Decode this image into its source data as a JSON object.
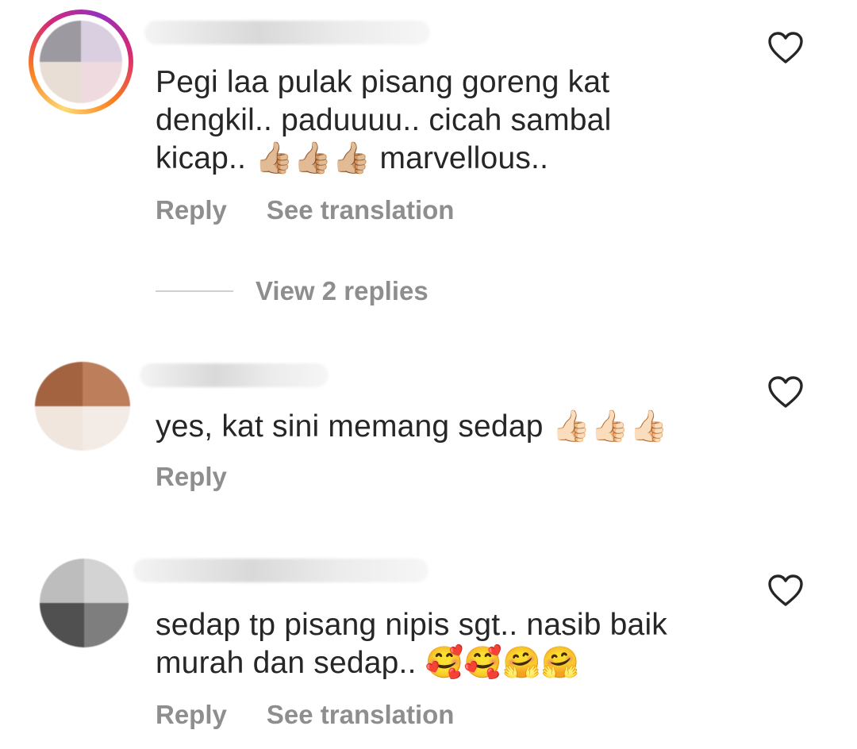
{
  "comments": [
    {
      "text": "Pegi laa pulak pisang goreng kat\ndengkil.. paduuuu.. cicah sambal\nkicap.. 👍🏼👍🏼👍🏼 marvellous..",
      "reply_label": "Reply",
      "translate_label": "See translation",
      "like_icon": "heart-outline-icon",
      "has_story_ring": true,
      "view_replies_label": "View 2 replies"
    },
    {
      "text": "yes, kat sini memang sedap 👍🏻👍🏻👍🏻",
      "reply_label": "Reply",
      "like_icon": "heart-outline-icon",
      "has_story_ring": false
    },
    {
      "text": "sedap tp pisang nipis sgt.. nasib baik\nmurah dan sedap.. 🥰🥰🤗🤗",
      "reply_label": "Reply",
      "translate_label": "See translation",
      "like_icon": "heart-outline-icon",
      "has_story_ring": false
    }
  ],
  "colors": {
    "text": "#262626",
    "secondary": "#8e8e8e",
    "divider": "#d0d0d0"
  }
}
